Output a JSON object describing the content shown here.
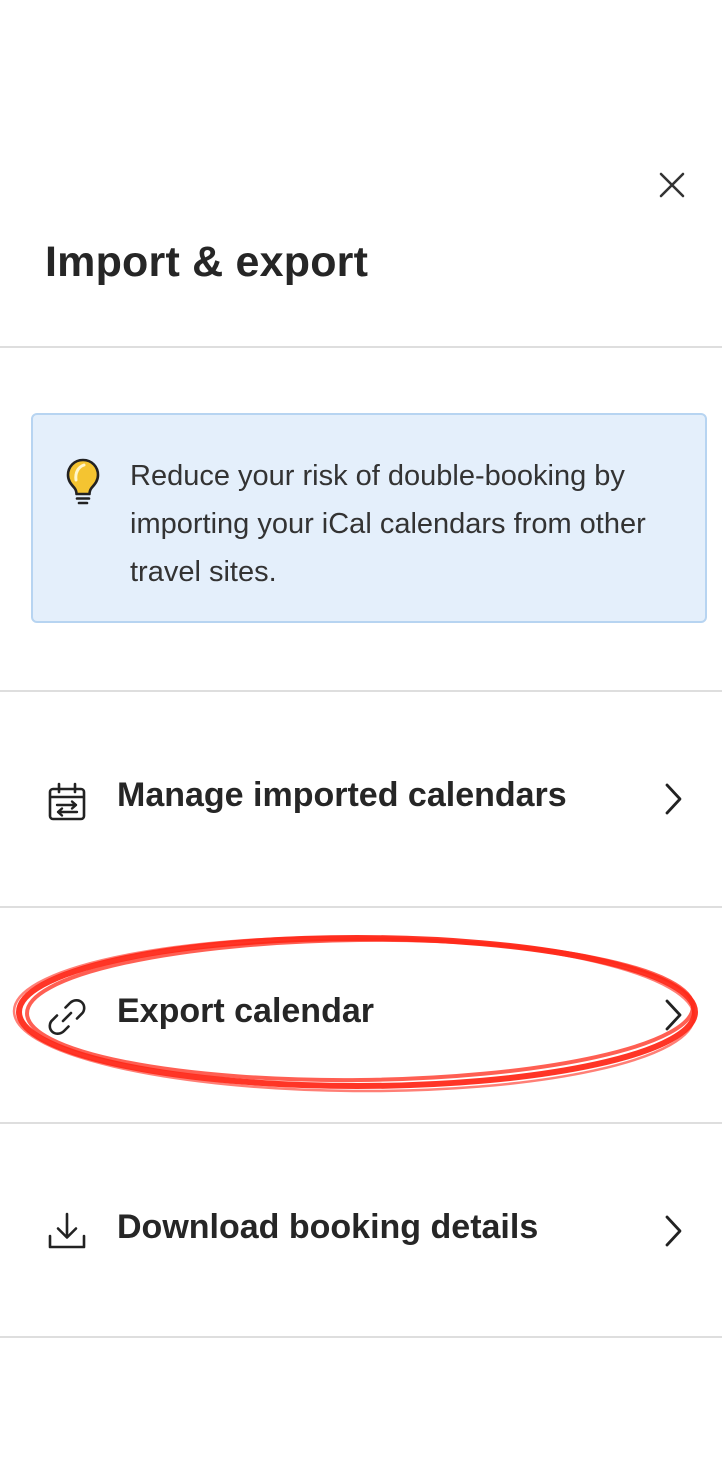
{
  "panel": {
    "title": "Import & export",
    "close_icon": "close-icon"
  },
  "info_banner": {
    "icon": "lightbulb-icon",
    "text": "Reduce your risk of double-booking by importing your iCal calendars from other travel sites.",
    "background": "#e4effb",
    "border": "#b7d4f1"
  },
  "menu": {
    "items": [
      {
        "label": "Manage imported calendars",
        "icon": "calendar-sync-icon"
      },
      {
        "label": "Export calendar",
        "icon": "link-icon",
        "highlighted": true
      },
      {
        "label": "Download booking details",
        "icon": "download-icon"
      }
    ],
    "chevron_icon": "chevron-right-icon"
  },
  "annotation": {
    "type": "hand-drawn ellipse",
    "color": "#ff2a1a",
    "target": "Export calendar"
  }
}
